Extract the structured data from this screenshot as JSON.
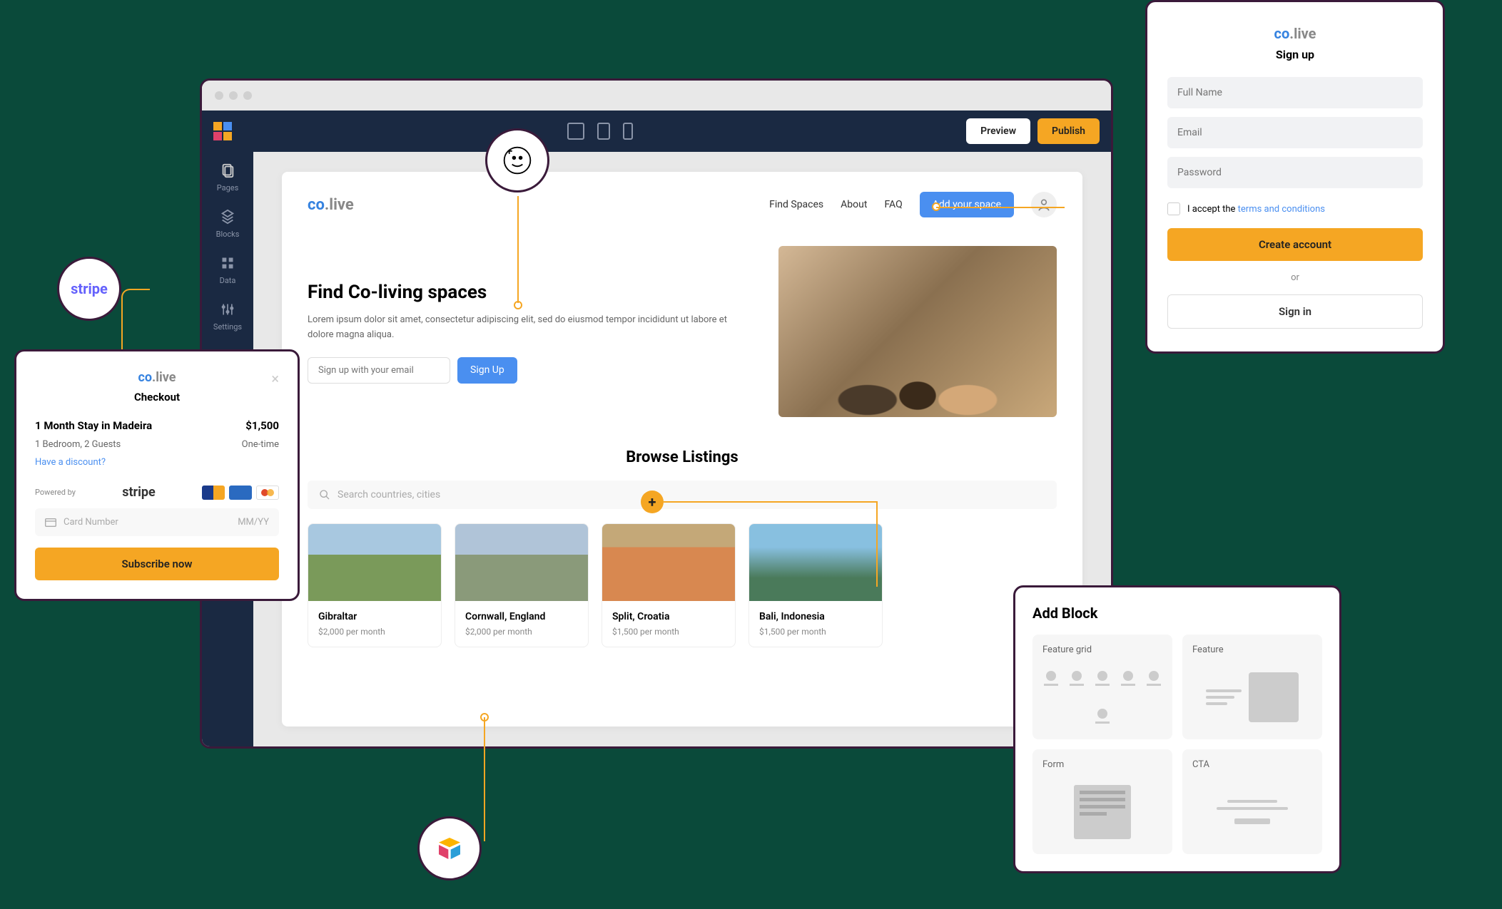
{
  "editor": {
    "preview_label": "Preview",
    "publish_label": "Publish",
    "rail": {
      "pages": "Pages",
      "blocks": "Blocks",
      "data": "Data",
      "settings": "Settings"
    }
  },
  "site": {
    "logo_co": "co",
    "logo_live": ".live",
    "nav": {
      "find_spaces": "Find Spaces",
      "about": "About",
      "faq": "FAQ",
      "add_space": "Add your space"
    },
    "hero": {
      "title": "Find Co-living spaces",
      "subtitle": "Lorem ipsum dolor sit amet, consectetur adipiscing elit, sed do eiusmod tempor incididunt ut labore et dolore magna aliqua.",
      "email_placeholder": "Sign up with your email",
      "signup_button": "Sign Up"
    },
    "browse": {
      "title": "Browse Listings",
      "search_placeholder": "Search countries, cities"
    },
    "listings": [
      {
        "title": "Gibraltar",
        "price": "$2,000 per month"
      },
      {
        "title": "Cornwall, England",
        "price": "$2,000 per month"
      },
      {
        "title": "Split, Croatia",
        "price": "$1,500 per month"
      },
      {
        "title": "Bali, Indonesia",
        "price": "$1,500 per month"
      }
    ]
  },
  "signup": {
    "heading": "Sign up",
    "full_name_placeholder": "Full Name",
    "email_placeholder": "Email",
    "password_placeholder": "Password",
    "accept_text": "I accept the ",
    "terms_text": "terms and conditions",
    "create_button": "Create account",
    "or_text": "or",
    "signin_button": "Sign in"
  },
  "checkout": {
    "title": "Checkout",
    "item_name": "1 Month Stay in Madeira",
    "item_price": "$1,500",
    "item_detail": "1 Bedroom, 2 Guests",
    "item_freq": "One-time",
    "discount_link": "Have a discount?",
    "powered_by": "Powered by",
    "stripe_text": "stripe",
    "card_placeholder": "Card Number",
    "expiry_placeholder": "MM/YY",
    "subscribe_button": "Subscribe now"
  },
  "addblock": {
    "title": "Add Block",
    "tiles": {
      "feature_grid": "Feature grid",
      "feature": "Feature",
      "form": "Form",
      "cta": "CTA"
    }
  },
  "integrations": {
    "stripe": "stripe"
  }
}
